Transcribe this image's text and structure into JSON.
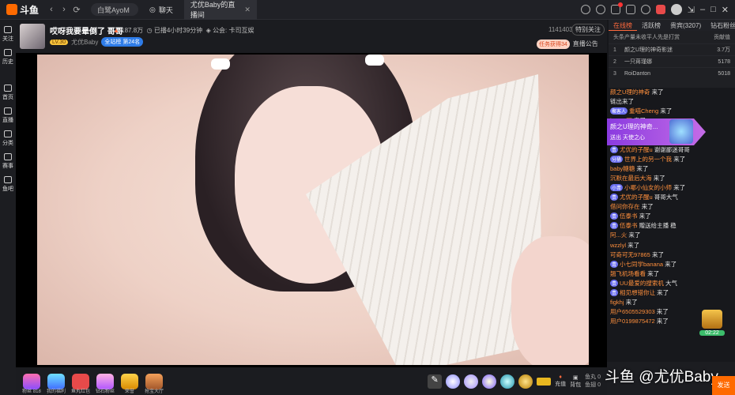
{
  "app": {
    "logo_text": "斗鱼"
  },
  "topbar": {
    "address_label": "白鹭AyoM",
    "chat_tab_label": "聊天",
    "active_tab_label": "尤优Baby的直播间",
    "tab_close": "✕",
    "icons": [
      "clock-icon",
      "heart-icon",
      "message-icon",
      "mail-icon",
      "gift-icon",
      "avatar",
      "pin-icon",
      "minimize-icon",
      "maximize-icon",
      "close-icon"
    ]
  },
  "sidebar": {
    "items": [
      {
        "label": "关注"
      },
      {
        "label": "历史"
      },
      {
        "label": "首页"
      },
      {
        "label": "直播"
      },
      {
        "label": "分类"
      },
      {
        "label": "赛事"
      },
      {
        "label": "鱼吧"
      }
    ]
  },
  "header": {
    "room_title": "哎呀我要晕倒了 哥哥",
    "heat": "187.8万",
    "live_duration": "已播4小时39分钟",
    "notice": "公会: 卡司互娱",
    "level": "LV.30",
    "anchor_name": "尤优Baby",
    "rank_badge": "全站榜 第24名",
    "room_id": "1141403",
    "follow_label": "特别关注",
    "task_label": "任务获得34",
    "cast_label": "直播公告"
  },
  "toolbar": {
    "buttons": [
      {
        "label": "粉丝 818"
      },
      {
        "label": "我的福利"
      },
      {
        "label": "鱼丸红包"
      },
      {
        "label": "钻石粉丝"
      },
      {
        "label": "荣誉"
      },
      {
        "label": "抢宝大厅"
      }
    ],
    "charge_label": "充值",
    "backpack_label": "背包",
    "fish_ball": "鱼丸",
    "fish_ball_value": "0",
    "yuchi": "鱼翅",
    "yuchi_value": "0"
  },
  "right_tabs": [
    "在线榜",
    "活跃榜",
    "贵宾(3207)",
    "钻石粉丝"
  ],
  "rank_panel": {
    "header_left": "头条产量未收平人先是打赏",
    "header_right": "贡献值",
    "rows": [
      {
        "rank": "1",
        "name": "颜之U理的神奇影迷",
        "value": "3.7万"
      },
      {
        "rank": "2",
        "name": "一只蒋瑾娜",
        "value": "5178"
      },
      {
        "rank": "3",
        "name": "RoiDanton",
        "value": "5018"
      }
    ]
  },
  "gift_banner": {
    "title": "颜之U理的神奇...",
    "sub": "送出  天使之心",
    "count": "x1"
  },
  "chat": {
    "messages": [
      {
        "badge": "",
        "user": "颜之U理的神奇",
        "text": " 来了"
      },
      {
        "badge": "",
        "user": "",
        "text": "链出来了"
      },
      {
        "badge": "聚客人",
        "user": "重喵Cheng",
        "text": " 来了"
      },
      {
        "badge": "",
        "user": "happy丽",
        "text": " 来了"
      },
      {
        "badge": "",
        "user": "",
        "text": ""
      },
      {
        "badge": "",
        "user": "",
        "text": ""
      },
      {
        "badge": "贵",
        "user": "尤优的子醒u",
        "text": " 谢谢鄙迷哥哥"
      },
      {
        "badge": "分桶",
        "user": "世界上的另一个我",
        "text": " 来了"
      },
      {
        "badge": "",
        "user": "baby糖糖",
        "text": " 来了"
      },
      {
        "badge": "",
        "user": "沉默在最后大海",
        "text": " 来了"
      },
      {
        "badge": "小青",
        "user": "小哪小仙女的小师",
        "text": " 来了"
      },
      {
        "badge": "贵",
        "user": "尤优的子醒u",
        "text": " 哥哥大气"
      },
      {
        "badge": "",
        "user": "借问你存在",
        "text": " 来了"
      },
      {
        "badge": "贵",
        "user": "伍泰书",
        "text": " 来了"
      },
      {
        "badge": "贵",
        "user": "伍泰书",
        "text": " 赠送给主播 稳"
      },
      {
        "badge": "",
        "user": "阿...火",
        "text": " 来了"
      },
      {
        "badge": "",
        "user": "wzzlyl",
        "text": " 来了"
      },
      {
        "badge": "",
        "user": "可奇可无97865",
        "text": " 来了"
      },
      {
        "badge": "青",
        "user": "小七同学banana",
        "text": " 来了"
      },
      {
        "badge": "",
        "user": "翘飞机场看看",
        "text": " 来了"
      },
      {
        "badge": "贵",
        "user": "UU最爱的搜索机",
        "text": " 大气"
      },
      {
        "badge": "贵",
        "user": "相见想错你让",
        "text": " 来了"
      },
      {
        "badge": "",
        "user": "figkhj",
        "text": " 来了"
      },
      {
        "badge": "",
        "user": "用户6505529303",
        "text": " 来了"
      },
      {
        "badge": "",
        "user": "用户0199875472",
        "text": " 来了"
      }
    ]
  },
  "treasure": {
    "timer": "02:22"
  },
  "chat_input": {
    "send_label": "发送"
  },
  "watermark": "斗鱼 @尤优Baby",
  "colors": {
    "accent": "#ff6a00",
    "banner": "#9a48e6",
    "vip": "#6b6ff0"
  }
}
